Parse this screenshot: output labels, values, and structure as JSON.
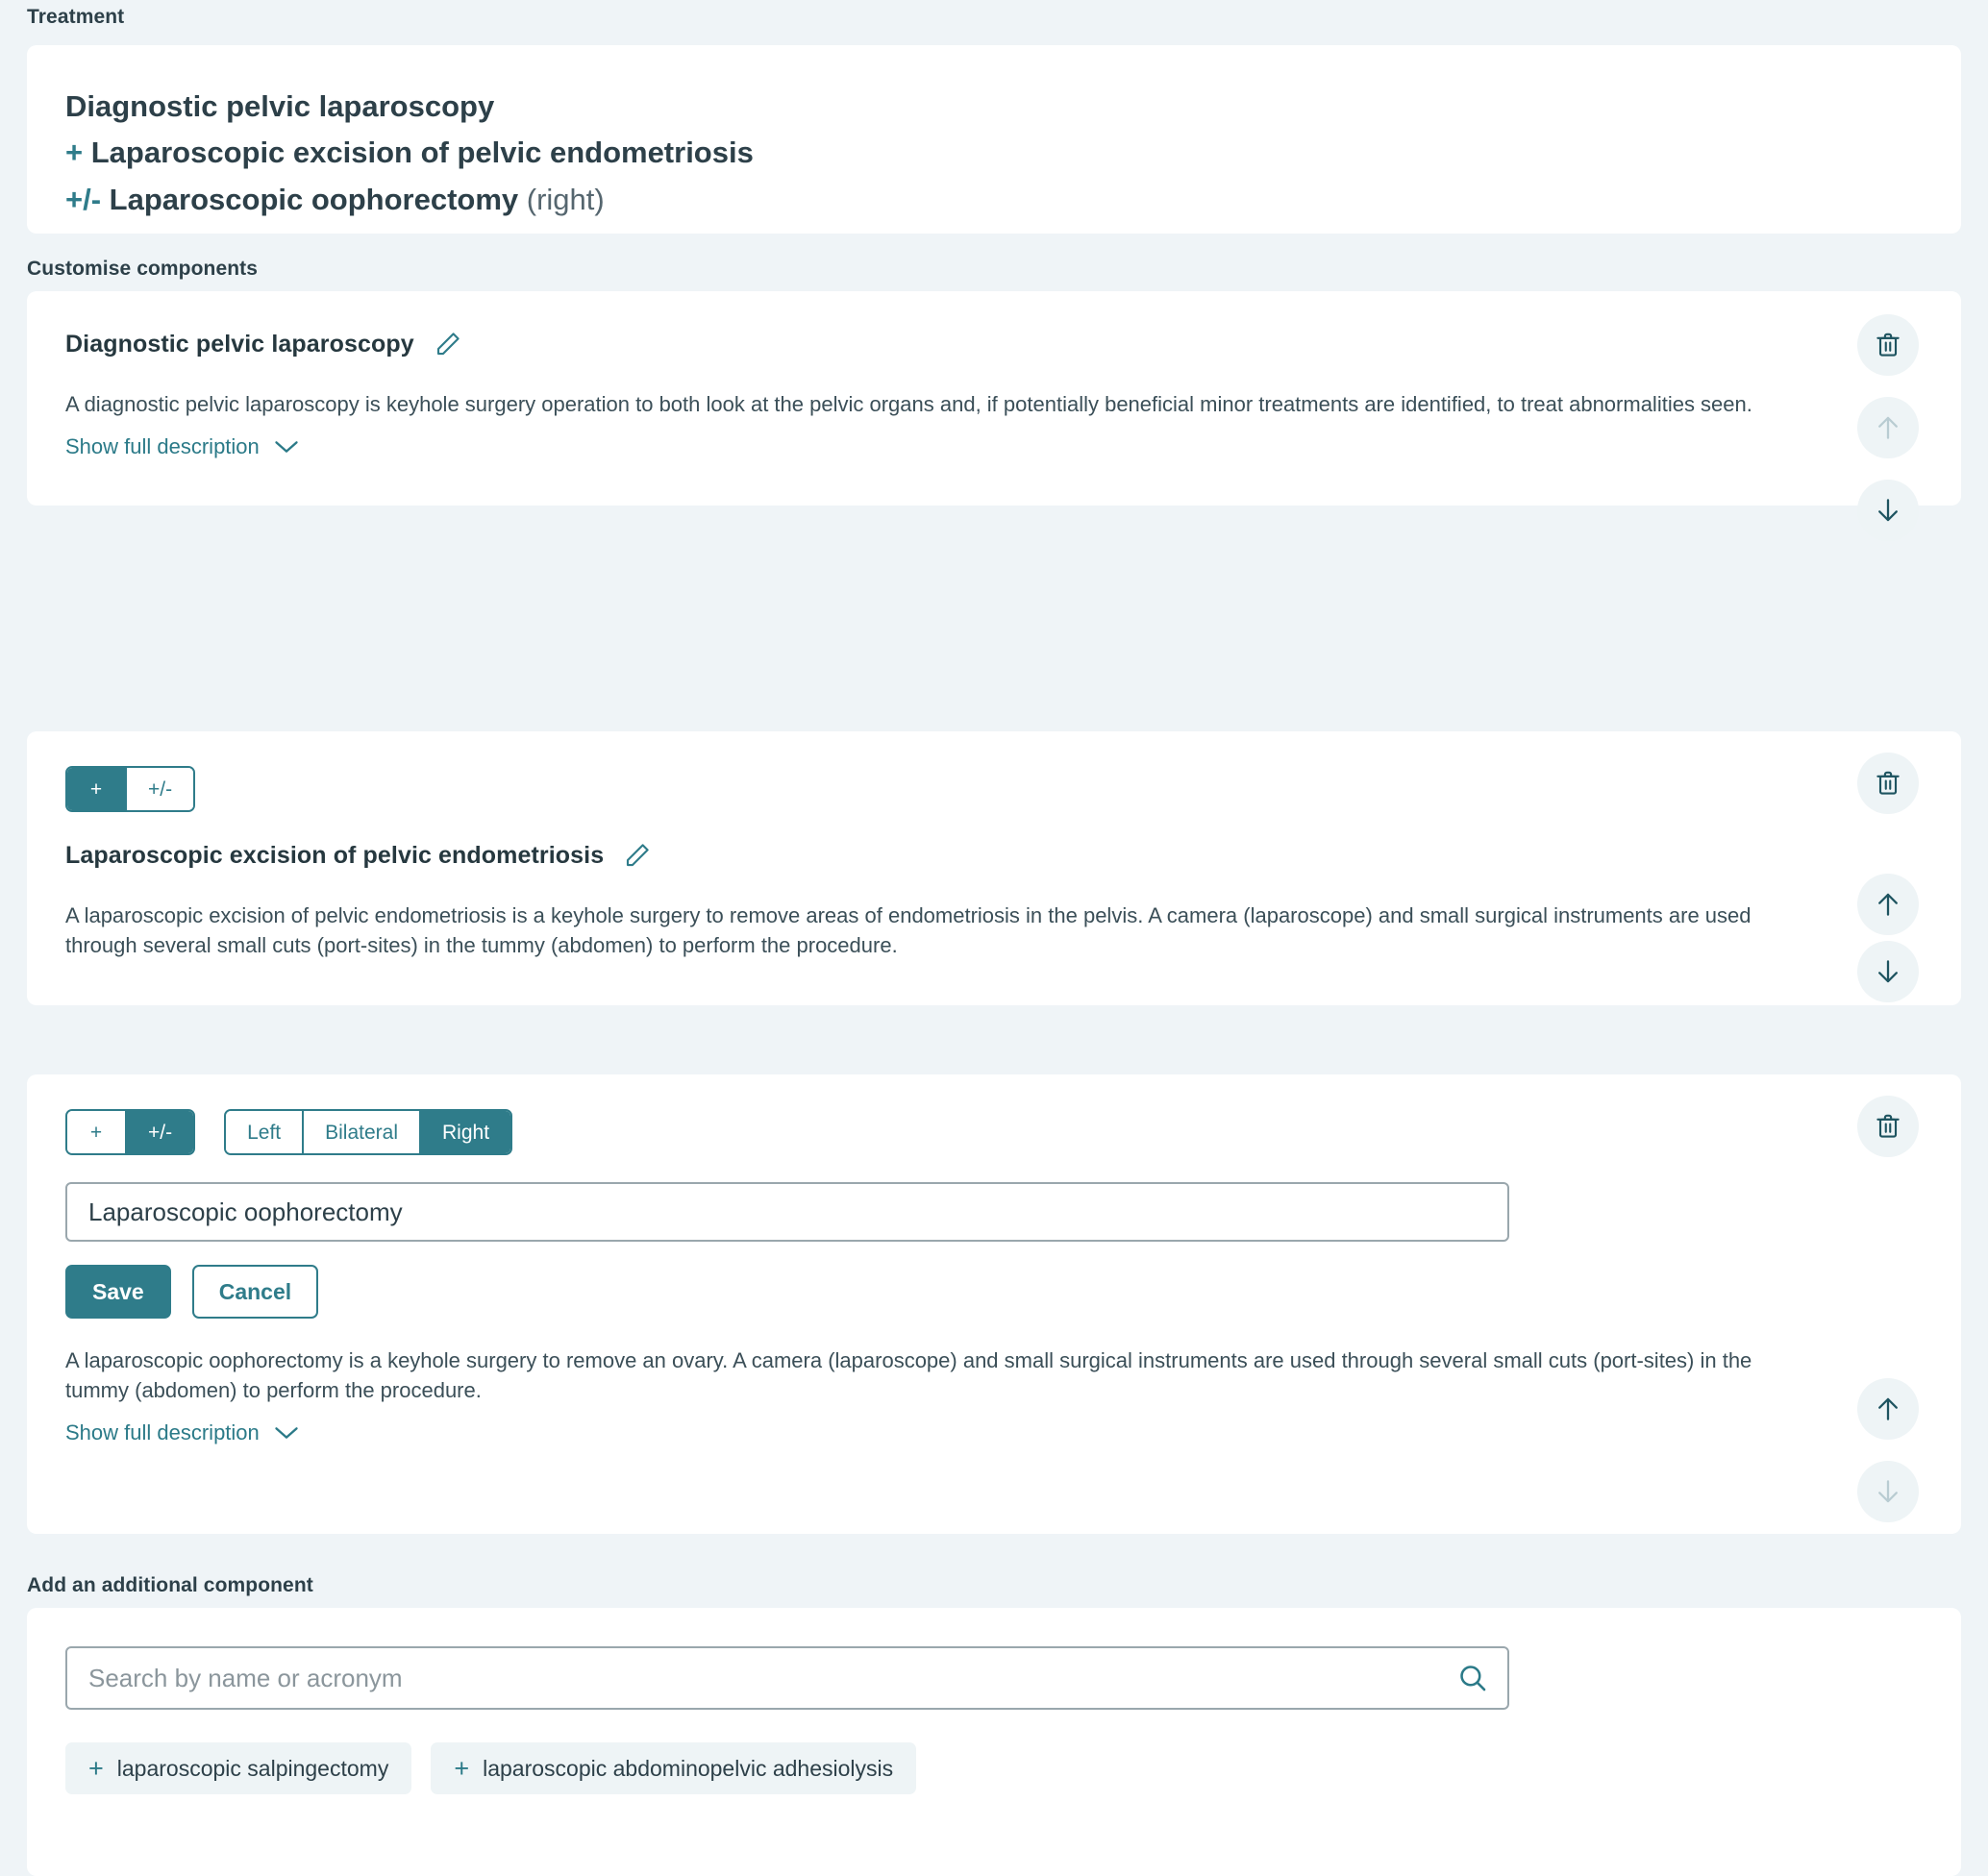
{
  "sections": {
    "treatment_label": "Treatment",
    "customise_label": "Customise components",
    "add_label": "Add an additional component"
  },
  "colors": {
    "accent": "#2f7c8a",
    "link": "#2b7a88",
    "page_bg": "#eff4f7",
    "card_bg": "#ffffff",
    "icon_bg": "#eef4f6",
    "text": "#2d4049",
    "disabled_icon": "#b9ccd2"
  },
  "summary": {
    "lines": [
      {
        "sign": "",
        "name": "Diagnostic pelvic laparoscopy",
        "note": ""
      },
      {
        "sign": "+",
        "name": "Laparoscopic excision of pelvic endometriosis",
        "note": ""
      },
      {
        "sign": "+/-",
        "name": "Laparoscopic oophorectomy",
        "note": "(right)"
      }
    ]
  },
  "components": [
    {
      "title": "Diagnostic pelvic laparoscopy",
      "description": "A diagnostic pelvic laparoscopy is keyhole surgery operation to both look at the pelvic organs and, if potentially beneficial minor treatments are identified, to treat abnormalities seen.",
      "show_full_label": "Show full description",
      "has_show_full": true,
      "has_optionality": false,
      "has_laterality": false,
      "editing": false,
      "actions": {
        "delete": "enabled",
        "up": "disabled",
        "down": "enabled"
      }
    },
    {
      "title": "Laparoscopic excision of pelvic endometriosis",
      "description": "A laparoscopic excision of pelvic endometriosis is a keyhole surgery to remove areas of endometriosis in the pelvis. A camera (laparoscope) and small surgical instruments are used through several small cuts (port-sites) in the tummy (abdomen) to perform the procedure.",
      "show_full_label": "Show full description",
      "has_show_full": false,
      "has_optionality": true,
      "optionality_options": [
        "+",
        "+/-"
      ],
      "optionality_selected": "+",
      "has_laterality": false,
      "editing": false,
      "actions": {
        "delete": "enabled",
        "up": "enabled",
        "down": "enabled"
      }
    },
    {
      "title": "Laparoscopic oophorectomy",
      "description": "A laparoscopic oophorectomy is a keyhole surgery to remove an ovary. A camera (laparoscope) and small surgical instruments are used through several small cuts (port-sites) in the tummy (abdomen) to perform the procedure.",
      "show_full_label": "Show full description",
      "has_show_full": true,
      "has_optionality": true,
      "optionality_options": [
        "+",
        "+/-"
      ],
      "optionality_selected": "+/-",
      "has_laterality": true,
      "laterality_options": [
        "Left",
        "Bilateral",
        "Right"
      ],
      "laterality_selected": "Right",
      "editing": true,
      "edit_value": "Laparoscopic oophorectomy",
      "save_label": "Save",
      "cancel_label": "Cancel",
      "actions": {
        "delete": "enabled",
        "up": "enabled",
        "down": "disabled"
      }
    }
  ],
  "search": {
    "placeholder": "Search by name or acronym",
    "value": "",
    "suggestions": [
      "laparoscopic salpingectomy",
      "laparoscopic abdominopelvic adhesiolysis"
    ],
    "plus_glyph": "+"
  }
}
